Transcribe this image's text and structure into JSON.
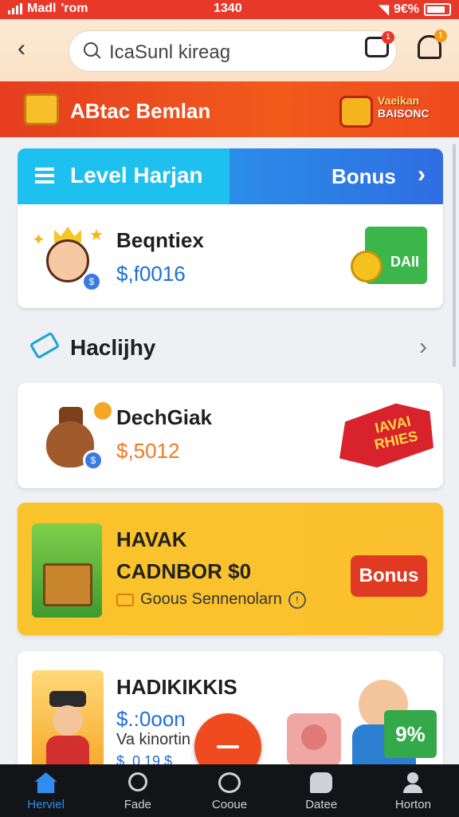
{
  "status_bar": {
    "carrier": "Madl",
    "app": "'rom",
    "time": "1340",
    "battery": "9€%"
  },
  "header": {
    "back": "‹",
    "search_text": "IcaSunl kireag",
    "cart_badge": "1",
    "bell_badge": "1"
  },
  "promo": {
    "title": "ABtac Bemlan",
    "badge_line1": "Vaeikan",
    "badge_line2": "BAISONC"
  },
  "level_banner": {
    "left_label": "Level Harjan",
    "right_label": "Bonus",
    "chevron": "›"
  },
  "card1": {
    "title": "Beqntiex",
    "price": "$,f0016",
    "price_color": "#1d6fd6",
    "money_label": "DAII"
  },
  "section": {
    "title": "Haclijhy",
    "chevron": "›"
  },
  "card2": {
    "title": "DechGiak",
    "price": "$,5012",
    "price_color": "#f07a22",
    "hot_label": "IAVAI RHIES"
  },
  "card3": {
    "title_line1": "HAVAK",
    "title_line2": "CADNBOR $0",
    "subtitle": "Goous Sennenolarn",
    "button": "Bonus"
  },
  "card4": {
    "title": "HADIKIKKIS",
    "price": "$.:0oon",
    "subtitle": "Va kinortin",
    "subtitle2": "$ .0 19 $",
    "percent": "9%"
  },
  "tabbar": {
    "tabs": [
      {
        "label": "Herviel",
        "icon": "home-icon"
      },
      {
        "label": "Fade",
        "icon": "search-icon"
      },
      {
        "label": "Cooue",
        "icon": "globe-icon"
      },
      {
        "label": "Datee",
        "icon": "chat-icon"
      },
      {
        "label": "Horton",
        "icon": "user-icon"
      }
    ],
    "active_color": "#2f8df0"
  }
}
